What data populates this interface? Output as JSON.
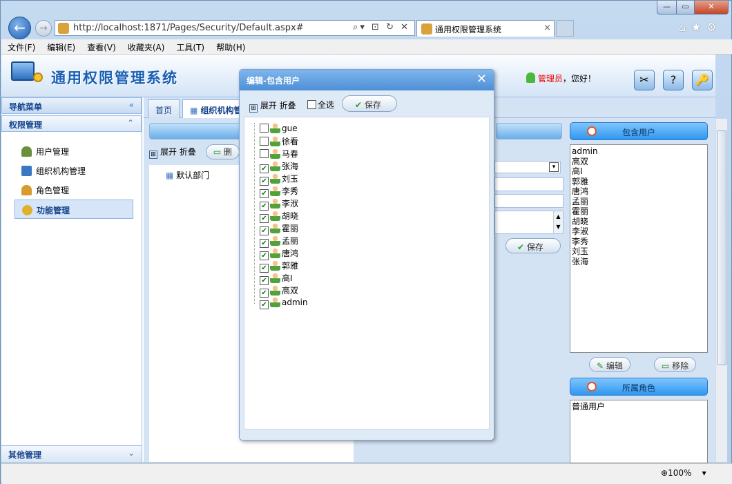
{
  "browser": {
    "url": "http://localhost:1871/Pages/Security/Default.aspx#",
    "tab_title": "通用权限管理系统",
    "tab_close": "×",
    "back": "←",
    "forward": "→",
    "url_tools": "⌕▾ ⊡ ↻ ✕",
    "right_icons": "⌂★⚙",
    "win_min": "—",
    "win_max": "▭",
    "win_close": "✕"
  },
  "menubar": [
    "文件(F)",
    "编辑(E)",
    "查看(V)",
    "收藏夹(A)",
    "工具(T)",
    "帮助(H)"
  ],
  "header": {
    "title": "通用权限管理系统",
    "user_role": "管理员",
    "user_greeting": "，您好！",
    "btn1": "✂",
    "btn2": "?",
    "btn3": "🔑"
  },
  "sidebar": {
    "nav_title": "导航菜单",
    "nav_chev": "«",
    "section": "权限管理",
    "section_chev": "⌃",
    "items": [
      {
        "label": "用户管理",
        "color": "#6a8f3d"
      },
      {
        "label": "组织机构管理",
        "color": "#3c77c2"
      },
      {
        "label": "角色管理",
        "color": "#d99a2f"
      },
      {
        "label": "功能管理",
        "color": "#e0b12a"
      }
    ],
    "footer": "其他管理",
    "footer_chev": "⌄"
  },
  "main": {
    "tabs": [
      "首页",
      "组织机构管"
    ],
    "panel_title": "组织",
    "expand": "展开",
    "collapse": "折叠",
    "del_label": "删",
    "dept_name": "默认部门",
    "save": "保存"
  },
  "right": {
    "included_users_title": "包含用户",
    "included_users": [
      "admin",
      "高双",
      "高I",
      "郭雅",
      "唐鸿",
      "孟丽",
      "霍丽",
      "胡晓",
      "李淑",
      "李秀",
      "刘玉",
      "张海"
    ],
    "edit": "编辑",
    "remove": "移除",
    "roles_title": "所属角色",
    "roles": [
      "普通用户"
    ]
  },
  "status": {
    "zoom": "100%",
    "zoom_arrow": "▾"
  },
  "dialog": {
    "title": "编辑-包含用户",
    "close": "✕",
    "expand": "展开",
    "collapse": "折叠",
    "select_all": "全选",
    "save": "保存",
    "users": [
      {
        "name": "gue",
        "checked": false
      },
      {
        "name": "徐看",
        "checked": false
      },
      {
        "name": "马春",
        "checked": false
      },
      {
        "name": "张海",
        "checked": true
      },
      {
        "name": "刘玉",
        "checked": true
      },
      {
        "name": "李秀",
        "checked": true
      },
      {
        "name": "李洑",
        "checked": true
      },
      {
        "name": "胡晓",
        "checked": true
      },
      {
        "name": "霍丽",
        "checked": true
      },
      {
        "name": "孟丽",
        "checked": true
      },
      {
        "name": "唐鸿",
        "checked": true
      },
      {
        "name": "郭雅",
        "checked": true
      },
      {
        "name": "高I",
        "checked": true
      },
      {
        "name": "高双",
        "checked": true
      },
      {
        "name": "admin",
        "checked": true
      }
    ]
  }
}
